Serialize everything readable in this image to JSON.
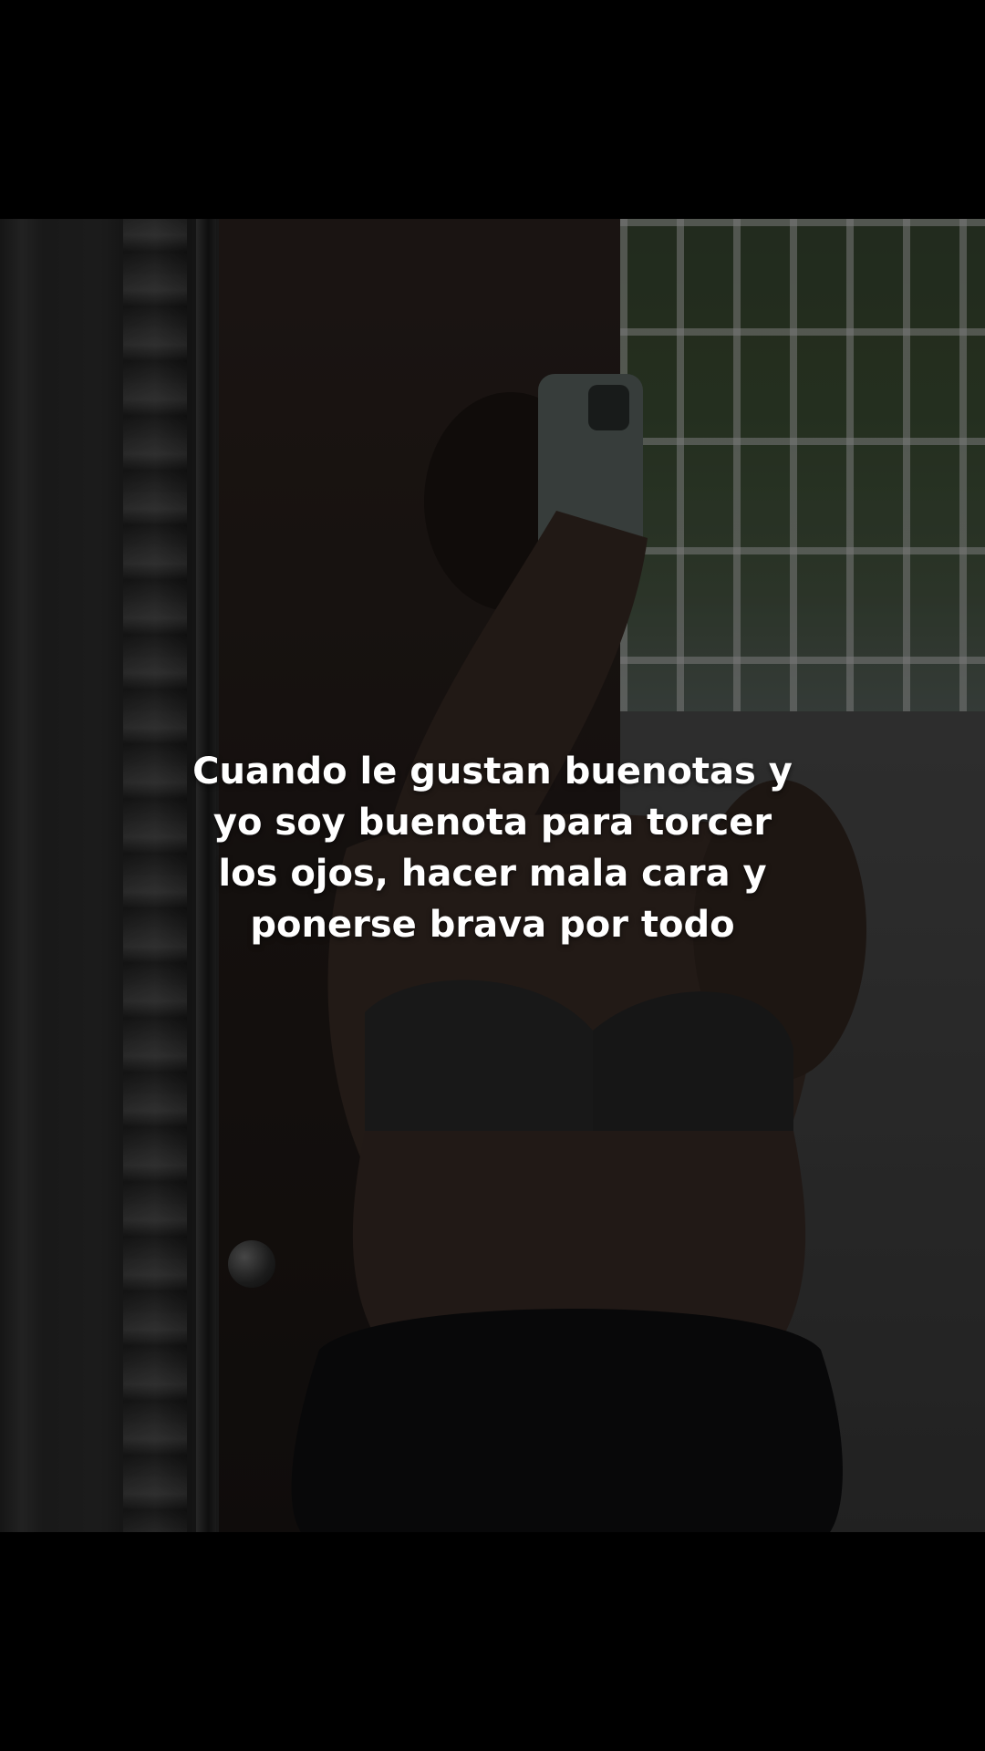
{
  "video": {
    "caption": "Cuando le gustan buenotas y yo soy buenota para torcer los ojos, hacer mala cara y ponerse brava por todo"
  },
  "colors": {
    "background": "#000000",
    "caption_text": "#ffffff"
  }
}
